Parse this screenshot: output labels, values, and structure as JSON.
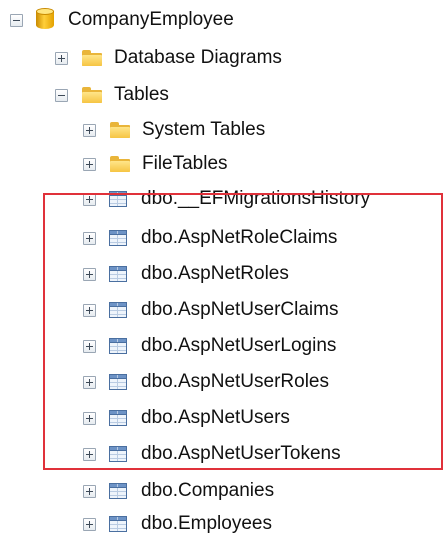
{
  "tree": {
    "database": {
      "label": "CompanyEmployee",
      "icon": "database-icon",
      "expanded": true
    },
    "nodes": {
      "database_diagrams": {
        "label": "Database Diagrams",
        "icon": "folder-icon",
        "expanded": false
      },
      "tables": {
        "label": "Tables",
        "icon": "folder-icon",
        "expanded": true
      },
      "system_tables": {
        "label": "System Tables",
        "icon": "folder-icon",
        "expanded": false
      },
      "file_tables": {
        "label": "FileTables",
        "icon": "folder-icon",
        "expanded": false
      }
    },
    "tables": [
      {
        "label": "dbo.__EFMigrationsHistory",
        "icon": "table-icon"
      },
      {
        "label": "dbo.AspNetRoleClaims",
        "icon": "table-icon"
      },
      {
        "label": "dbo.AspNetRoles",
        "icon": "table-icon"
      },
      {
        "label": "dbo.AspNetUserClaims",
        "icon": "table-icon"
      },
      {
        "label": "dbo.AspNetUserLogins",
        "icon": "table-icon"
      },
      {
        "label": "dbo.AspNetUserRoles",
        "icon": "table-icon"
      },
      {
        "label": "dbo.AspNetUsers",
        "icon": "table-icon"
      },
      {
        "label": "dbo.AspNetUserTokens",
        "icon": "table-icon"
      },
      {
        "label": "dbo.Companies",
        "icon": "table-icon"
      },
      {
        "label": "dbo.Employees",
        "icon": "table-icon"
      }
    ]
  },
  "highlight": {
    "color": "#e0313a"
  }
}
